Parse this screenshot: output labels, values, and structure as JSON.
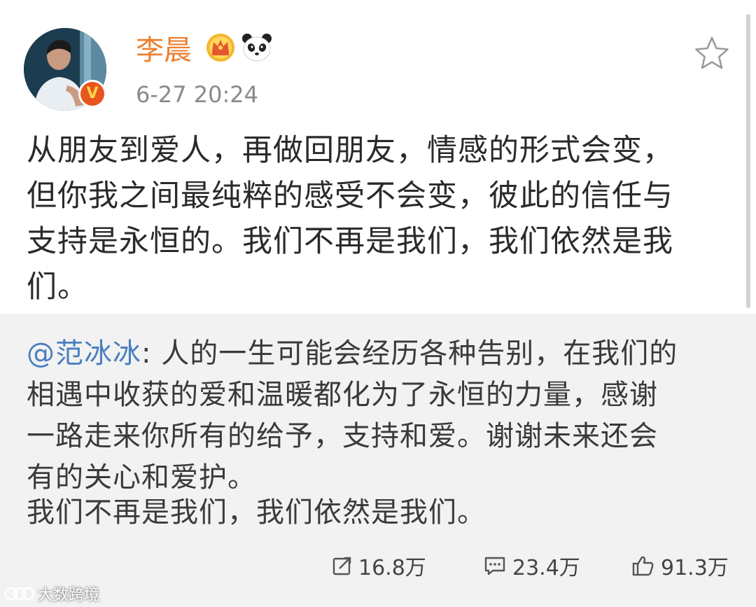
{
  "post": {
    "author": "李晨",
    "timestamp": "6-27 20:24",
    "body_lines": [
      "从朋友到爱人，再做回朋友，情感的形式会变，",
      "但你我之间最纯粹的感受不会变，彼此的信任与",
      "支持是永恒的。我们不再是我们，我们依然是我",
      "们。"
    ]
  },
  "repost": {
    "mention": "@范冰冰",
    "line1_rest": ": 人的一生可能会经历各种告别，在我们的",
    "lines": [
      "相遇中收获的爱和温暖都化为了永恒的力量，感谢",
      "一路走来你所有的给予，支持和爱。谢谢未来还会",
      "有的关心和爱护。"
    ],
    "closing": "我们不再是我们，我们依然是我们。"
  },
  "stats": {
    "reposts": "16.8万",
    "comments": "23.4万",
    "likes": "91.3万"
  },
  "watermark": {
    "text": "大数跨境"
  },
  "colors": {
    "author": "#eb7f2e",
    "mention": "#4a7fbf",
    "repost_bg": "#f2f2f2",
    "verified_badge": "#e8551f"
  },
  "icons": {
    "verified": "verified-v-badge-icon",
    "member": "crown-icon",
    "panda": "panda-icon",
    "favorite": "star-icon",
    "repost": "repost-icon",
    "comment": "comment-icon",
    "like": "thumbs-up-icon"
  }
}
